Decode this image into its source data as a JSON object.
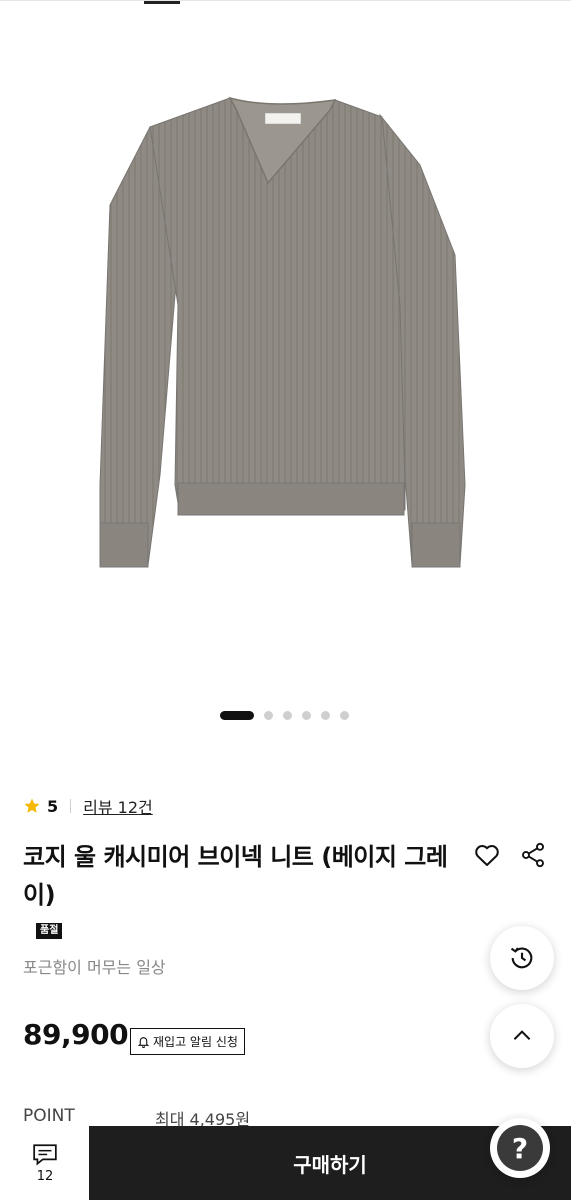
{
  "product": {
    "rating": "5",
    "review_link": "리뷰 12건",
    "title": "코지 울 캐시미어 브이넥 니트 (베이지 그레이)",
    "badge": "품절",
    "subtitle": "포근함이 머무는 일상",
    "price": "89,900",
    "restock_label": "재입고 알림 신청",
    "image_label": "Cozy Wool V-neck"
  },
  "carousel": {
    "total": 6,
    "active": 1
  },
  "point": {
    "label": "POINT",
    "value": "최대 4,495원"
  },
  "bottom": {
    "comment_count": "12",
    "buy_label": "구매하기"
  },
  "floating": {
    "help_label": "?"
  },
  "colors": {
    "primary": "#1e1e1e",
    "star": "#f5b800",
    "sweater": "#8e8a83"
  },
  "icons": [
    "star-icon",
    "heart-icon",
    "share-icon",
    "history-icon",
    "chevron-up-icon",
    "bell-icon",
    "comment-icon",
    "question-icon"
  ]
}
